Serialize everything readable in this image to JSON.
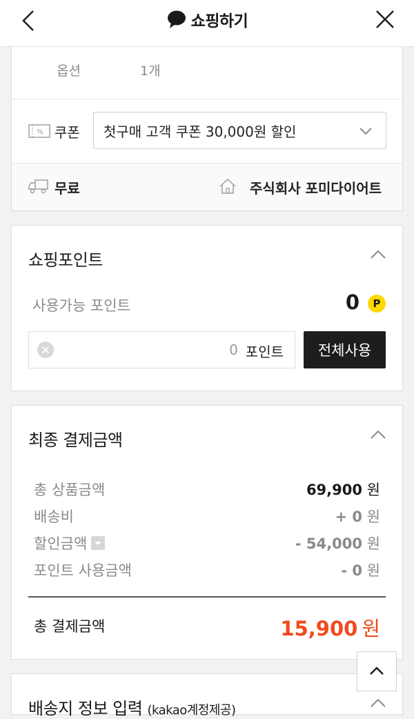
{
  "header": {
    "title": "쇼핑하기"
  },
  "order": {
    "option_key": "옵션",
    "option_value": "1개",
    "coupon_label": "쿠폰",
    "coupon_selected": "첫구매 고객 쿠폰 30,000원 할인",
    "shipping_label": "무료",
    "seller": "주식회사 포미다이어트"
  },
  "points": {
    "title": "쇼핑포인트",
    "available_label": "사용가능 포인트",
    "available_value": "0",
    "badge": "P",
    "input_value": "0",
    "input_unit": "포인트",
    "use_all_label": "전체사용"
  },
  "payment": {
    "title": "최종 결제금액",
    "lines": [
      {
        "label": "총 상품금액",
        "value": "69,900",
        "unit": "원"
      },
      {
        "label": "배송비",
        "value": "+ 0",
        "unit": "원"
      },
      {
        "label": "할인금액",
        "value": "- 54,000",
        "unit": "원"
      },
      {
        "label": "포인트 사용금액",
        "value": "- 0",
        "unit": "원"
      }
    ],
    "final_label": "총 결제금액",
    "final_value": "15,900",
    "final_unit": "원"
  },
  "delivery": {
    "title": "배송지 정보 입력",
    "title_sub": "(kakao계정제공)"
  },
  "colors": {
    "accent": "#f04a1e",
    "point_badge": "#ffd800",
    "button_dark": "#1d1d1d"
  },
  "icons": [
    "back-arrow-icon",
    "chat-bubble-icon",
    "close-icon",
    "coupon-icon",
    "chevron-down-icon",
    "truck-icon",
    "home-icon",
    "chevron-up-icon",
    "clear-icon",
    "dropdown-mini-icon",
    "scroll-top-icon"
  ]
}
